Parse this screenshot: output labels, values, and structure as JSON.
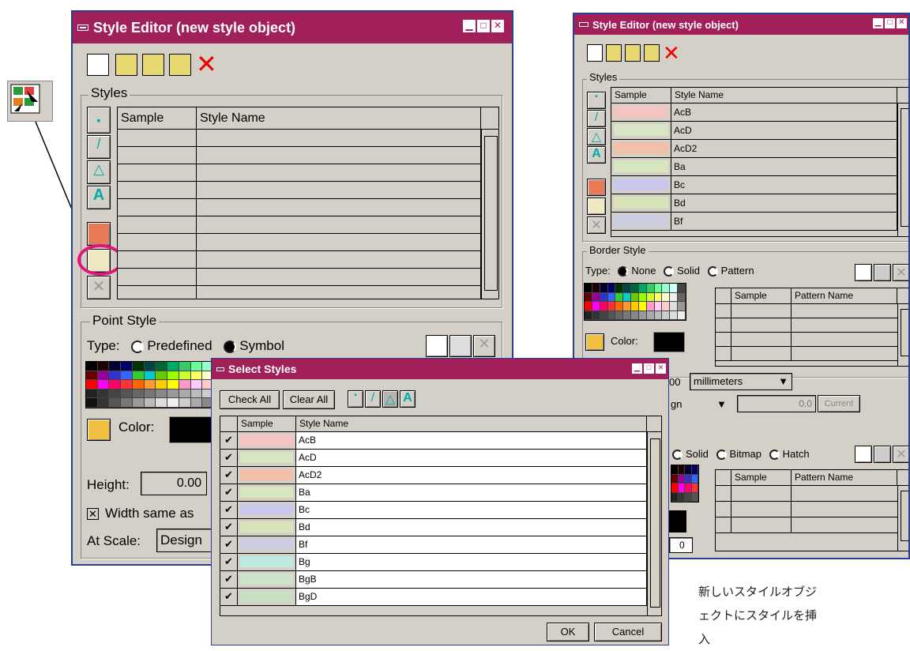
{
  "main_window": {
    "title": "Style Editor (new style object)",
    "styles_group": "Styles",
    "col_sample": "Sample",
    "col_name": "Style Name",
    "point_group": "Point Style",
    "type_label": "Type:",
    "opt_predefined": "Predefined",
    "opt_symbol": "Symbol",
    "color_label": "Color:",
    "height_label": "Height:",
    "height_value": "0.00",
    "width_same": "Width same as",
    "at_scale_label": "At Scale:",
    "at_scale_value": "Design"
  },
  "right_window": {
    "title": "Style Editor (new style object)",
    "styles_group": "Styles",
    "col_sample": "Sample",
    "col_name": "Style Name",
    "styles": [
      "AcB",
      "AcD",
      "AcD2",
      "Ba",
      "Bc",
      "Bd",
      "Bf"
    ],
    "border_group": "Border Style",
    "type_label": "Type:",
    "opt_none": "None",
    "opt_solid": "Solid",
    "opt_pattern": "Pattern",
    "col_pattern_sample": "Sample",
    "col_pattern_name": "Pattern Name",
    "color_label": "Color:",
    "width_partial": "00",
    "units": "millimeters",
    "scale_partial": "gn",
    "scale_value": "0.0",
    "current_button": "Current",
    "opt_solid2": "Solid",
    "opt_bitmap": "Bitmap",
    "opt_hatch": "Hatch",
    "col_fill_sample": "Sample",
    "col_fill_name": "Pattern Name",
    "fill_value_partial": "0"
  },
  "dialog": {
    "title": "Select Styles",
    "check_all": "Check All",
    "clear_all": "Clear All",
    "col_sample": "Sample",
    "col_name": "Style Name",
    "rows": [
      {
        "name": "AcB",
        "checked": true
      },
      {
        "name": "AcD",
        "checked": true
      },
      {
        "name": "AcD2",
        "checked": true
      },
      {
        "name": "Ba",
        "checked": true
      },
      {
        "name": "Bc",
        "checked": true
      },
      {
        "name": "Bd",
        "checked": true
      },
      {
        "name": "Bf",
        "checked": true
      },
      {
        "name": "Bg",
        "checked": true
      },
      {
        "name": "BgB",
        "checked": true
      },
      {
        "name": "BgD",
        "checked": true
      }
    ],
    "ok": "OK",
    "cancel": "Cancel"
  },
  "swatch_colors": [
    "#f4c5c0",
    "#d6e5c4",
    "#f2c0a8",
    "#d8e6c0",
    "#c9c8ec",
    "#d8e4b8",
    "#cccce0",
    "#bfe8e0",
    "#cfe3c8",
    "#c8e0c0"
  ],
  "annotation": "新しいスタイルオブジェクトにスタイルを挿入",
  "accent_color": "#a22059",
  "highlight_color": "#e0167a"
}
